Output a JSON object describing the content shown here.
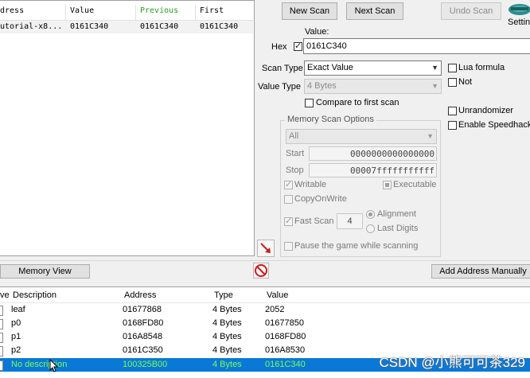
{
  "found_list": {
    "columns": [
      "dress",
      "Value",
      "Previous",
      "First"
    ],
    "rows": [
      {
        "address": "utorial-x8...",
        "value": "0161C340",
        "previous": "0161C340",
        "first": "0161C340"
      }
    ]
  },
  "buttons": {
    "new_scan": "New Scan",
    "next_scan": "Next Scan",
    "undo_scan": "Undo Scan",
    "memory_view": "Memory View",
    "add_address_manually": "Add Address Manually"
  },
  "settings": {
    "label": "Setting"
  },
  "value": {
    "label": "Value:",
    "hex_label": "Hex",
    "text": "0161C340"
  },
  "scan_type": {
    "label": "Scan Type",
    "selected": "Exact Value"
  },
  "value_type": {
    "label": "Value Type",
    "selected": "4 Bytes"
  },
  "compare_first": "Compare to first scan",
  "right_options": {
    "lua_formula": "Lua formula",
    "not": "Not",
    "unrandomizer": "Unrandomizer",
    "enable_speedhack": "Enable Speedhack"
  },
  "memory_scan_options": {
    "title": "Memory Scan Options",
    "region": "All",
    "start_label": "Start",
    "start_value": "0000000000000000",
    "stop_label": "Stop",
    "stop_value": "00007fffffffffff",
    "writable": "Writable",
    "executable": "Executable",
    "copy_on_write": "CopyOnWrite",
    "fast_scan": "Fast Scan",
    "fast_scan_value": "4",
    "alignment": "Alignment",
    "last_digits": "Last Digits",
    "pause_game": "Pause the game while scanning"
  },
  "address_list": {
    "columns": [
      "ve",
      "Description",
      "Address",
      "Type",
      "Value"
    ],
    "rows": [
      {
        "description": "leaf",
        "address": "01677868",
        "type": "4 Bytes",
        "value": "2052"
      },
      {
        "description": "p0",
        "address": "0168FD80",
        "type": "4 Bytes",
        "value": "01677850"
      },
      {
        "description": "p1",
        "address": "016A8548",
        "type": "4 Bytes",
        "value": "0168FD80"
      },
      {
        "description": "p2",
        "address": "0161C350",
        "type": "4 Bytes",
        "value": "016A8530"
      },
      {
        "description": "No description",
        "address": "100325B00",
        "type": "4 Bytes",
        "value": "0161C340"
      }
    ]
  },
  "watermark": "CSDN @小熊可可茶329",
  "colors": {
    "selection": "#0a78d7",
    "arrow_red": "#c81e1e",
    "logo": "#2e8b8b"
  }
}
